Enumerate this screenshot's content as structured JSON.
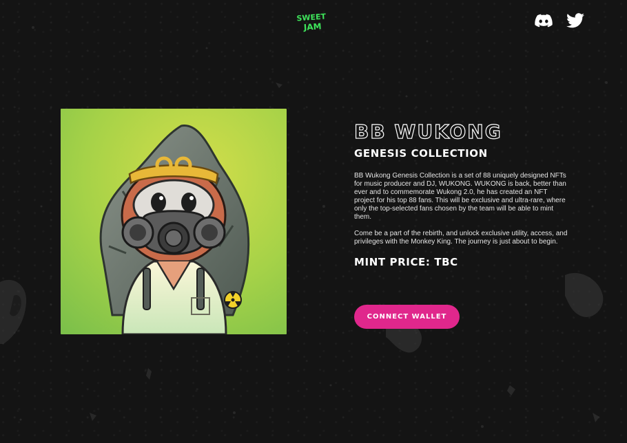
{
  "header": {
    "logo_text_top": "SWEET",
    "logo_text_bottom": "JAM",
    "logo_color": "#3ee35a",
    "social": [
      {
        "name": "discord",
        "icon": "discord-icon"
      },
      {
        "name": "twitter",
        "icon": "twitter-icon"
      }
    ]
  },
  "hero": {
    "title": "BB WUKONG",
    "subtitle": "GENESIS COLLECTION",
    "description_1": "BB Wukong Genesis Collection is a set of 88 uniquely designed NFTs for music producer and DJ, WUKONG. WUKONG is back, better than ever and to commemorate Wukong 2.0, he has created an NFT project for his top 88 fans. This will be exclusive and ultra-rare, where only the top-selected fans chosen by the team will be able to mint them.",
    "description_2": "Come be a part of the rebirth, and unlock exclusive utility, access, and privileges with the Monkey King. The journey is just about to begin.",
    "mint_price": "MINT PRICE: TBC",
    "connect_label": "CONNECT WALLET"
  },
  "colors": {
    "background": "#141414",
    "accent": "#e0278c",
    "art_background": "#9fd14a"
  }
}
